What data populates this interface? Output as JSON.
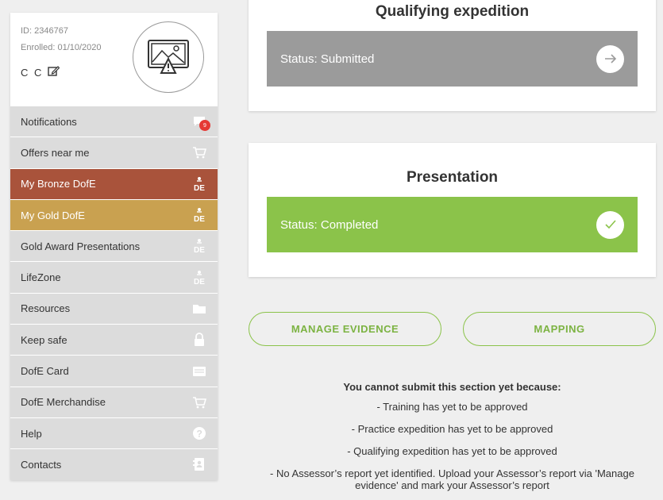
{
  "profile": {
    "id": "ID: 2346767",
    "enrolled": "Enrolled: 01/10/2020",
    "name": "C C"
  },
  "menu": [
    {
      "label": "Notifications",
      "icon": "chat-icon",
      "badge": "9"
    },
    {
      "label": "Offers near me",
      "icon": "cart-icon"
    },
    {
      "label": "My Bronze DofE",
      "icon": "dofe-icon"
    },
    {
      "label": "My Gold DofE",
      "icon": "dofe-icon"
    },
    {
      "label": "Gold Award Presentations",
      "icon": "dofe-icon"
    },
    {
      "label": "LifeZone",
      "icon": "dofe-icon"
    },
    {
      "label": "Resources",
      "icon": "folder-icon"
    },
    {
      "label": "Keep safe",
      "icon": "lock-icon"
    },
    {
      "label": "DofE Card",
      "icon": "card-icon"
    },
    {
      "label": "DofE Merchandise",
      "icon": "cart-icon"
    },
    {
      "label": "Help",
      "icon": "help-icon"
    },
    {
      "label": "Contacts",
      "icon": "contacts-icon"
    }
  ],
  "dofe_icon_text": "DE",
  "qualifying": {
    "title": "Qualifying expedition",
    "status": "Status: Submitted"
  },
  "presentation": {
    "title": "Presentation",
    "status": "Status: Completed"
  },
  "buttons": {
    "manage_evidence": "MANAGE EVIDENCE",
    "mapping": "MAPPING"
  },
  "notice": {
    "heading": "You cannot submit this section yet because:",
    "items": [
      "- Training has yet to be approved",
      "- Practice expedition has yet to be approved",
      "- Qualifying expedition has yet to be approved",
      "- No Assessor’s report yet identified. Upload your Assessor’s report via 'Manage evidence' and mark your Assessor’s report"
    ]
  },
  "colors": {
    "bronze": "#a9533b",
    "gold": "#c9a150",
    "green": "#8bc34a",
    "grey_status": "#9b9b9b",
    "badge": "#e53935"
  }
}
